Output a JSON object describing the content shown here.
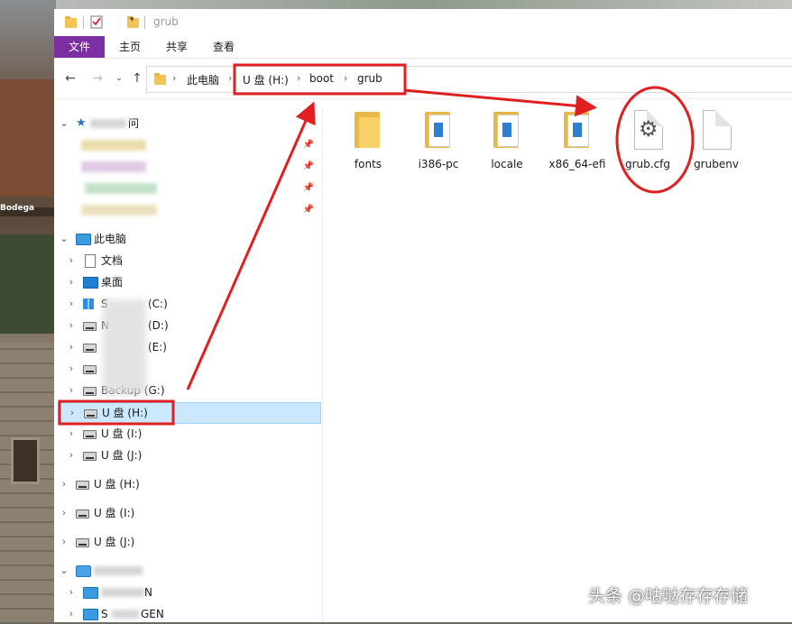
{
  "window": {
    "title": "grub"
  },
  "ribbon": {
    "tabs": [
      {
        "label": "文件"
      },
      {
        "label": "主页"
      },
      {
        "label": "共享"
      },
      {
        "label": "查看"
      }
    ]
  },
  "navigation": {
    "breadcrumbs": [
      {
        "label": "此电脑"
      },
      {
        "label": "U 盘 (H:)"
      },
      {
        "label": "boot"
      },
      {
        "label": "grub"
      }
    ]
  },
  "nav_pane": {
    "quick_access_suffix": "问",
    "this_pc": "此电脑",
    "items": [
      {
        "label": "文档",
        "icon": "document-icon"
      },
      {
        "label": "桌面",
        "icon": "desktop-icon"
      },
      {
        "label": "(C:)",
        "prefix": "S",
        "icon": "windows-drive-icon"
      },
      {
        "label": "(D:)",
        "prefix": "N",
        "icon": "drive-icon"
      },
      {
        "label": "(E:)",
        "prefix": "",
        "icon": "drive-icon"
      },
      {
        "label": "",
        "icon": "drive-icon"
      },
      {
        "label": "Backup (G:)",
        "icon": "drive-icon"
      },
      {
        "label": "U 盘 (H:)",
        "icon": "drive-icon",
        "selected": true
      },
      {
        "label": "U 盘 (I:)",
        "icon": "drive-icon"
      },
      {
        "label": "U 盘 (J:)",
        "icon": "drive-icon"
      }
    ],
    "root_drives": [
      {
        "label": "U 盘 (H:)"
      },
      {
        "label": "U 盘 (I:)"
      },
      {
        "label": "U 盘 (J:)"
      }
    ],
    "network": [
      {
        "label": "N"
      },
      {
        "label": "GEN",
        "prefix": "S"
      }
    ]
  },
  "files": [
    {
      "name": "fonts",
      "type": "folder"
    },
    {
      "name": "i386-pc",
      "type": "folder-docs"
    },
    {
      "name": "locale",
      "type": "folder-docs"
    },
    {
      "name": "x86_64-efi",
      "type": "folder-docs"
    },
    {
      "name": "grub.cfg",
      "type": "config"
    },
    {
      "name": "grubenv",
      "type": "file"
    }
  ],
  "watermark": "头条 @咕哒存存存储",
  "colors": {
    "file_tab": "#7c2fa3",
    "annotation_red": "#e02020",
    "selection": "#cce8ff"
  }
}
